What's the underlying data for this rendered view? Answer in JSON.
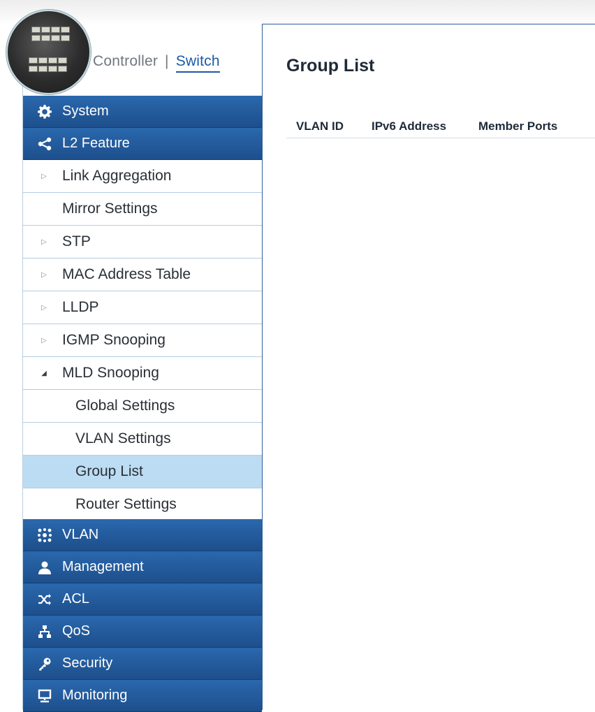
{
  "header": {
    "controller_label": "Controller",
    "separator": "|",
    "switch_label": "Switch"
  },
  "sidebar": {
    "main_items": [
      {
        "label": "System",
        "icon": "gear-icon"
      },
      {
        "label": "L2 Feature",
        "icon": "share-icon"
      },
      {
        "label": "VLAN",
        "icon": "vlan-icon"
      },
      {
        "label": "Management",
        "icon": "user-icon"
      },
      {
        "label": "ACL",
        "icon": "shuffle-icon"
      },
      {
        "label": "QoS",
        "icon": "network-icon"
      },
      {
        "label": "Security",
        "icon": "key-icon"
      },
      {
        "label": "Monitoring",
        "icon": "monitor-icon"
      }
    ],
    "l2_items": [
      {
        "label": "Link Aggregation",
        "expander": "collapsed"
      },
      {
        "label": "Mirror Settings",
        "expander": "none"
      },
      {
        "label": "STP",
        "expander": "collapsed"
      },
      {
        "label": "MAC Address Table",
        "expander": "collapsed"
      },
      {
        "label": "LLDP",
        "expander": "collapsed"
      },
      {
        "label": "IGMP Snooping",
        "expander": "collapsed"
      },
      {
        "label": "MLD Snooping",
        "expander": "expanded"
      }
    ],
    "mld_items": [
      {
        "label": "Global Settings",
        "selected": false
      },
      {
        "label": "VLAN Settings",
        "selected": false
      },
      {
        "label": "Group List",
        "selected": true
      },
      {
        "label": "Router Settings",
        "selected": false
      }
    ]
  },
  "main": {
    "title": "Group List",
    "columns": [
      "VLAN ID",
      "IPv6 Address",
      "Member Ports"
    ]
  },
  "colors": {
    "nav_blue": "#1d4f8c",
    "selected_row": "#bcdcf3",
    "accent_link": "#1c5aa8"
  }
}
